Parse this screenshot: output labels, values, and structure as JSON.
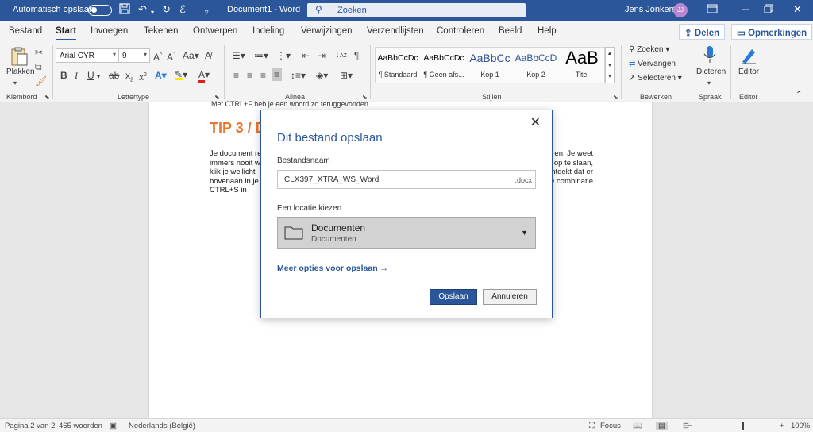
{
  "titlebar": {
    "autosave_label": "Automatisch opslaan",
    "doc_title": "Document1  -  Word",
    "search_placeholder": "Zoeken",
    "user_name": "Jens Jonkers",
    "user_initials": "JJ",
    "accent": "#2b579a"
  },
  "tabs": [
    "Bestand",
    "Start",
    "Invoegen",
    "Tekenen",
    "Ontwerpen",
    "Indeling",
    "Verwijzingen",
    "Verzendlijsten",
    "Controleren",
    "Beeld",
    "Help"
  ],
  "active_tab": "Start",
  "share": {
    "share_label": "Delen",
    "comments_label": "Opmerkingen"
  },
  "ribbon": {
    "clipboard": {
      "paste_label": "Plakken",
      "group_label": "Klembord"
    },
    "font": {
      "font_name": "Arial CYR",
      "font_size": "9",
      "group_label": "Lettertype",
      "aa_label": "Aa"
    },
    "paragraph": {
      "group_label": "Alinea"
    },
    "styles": {
      "group_label": "Stijlen",
      "items": [
        {
          "preview": "AaBbCcDc",
          "name": "¶ Standaard"
        },
        {
          "preview": "AaBbCcDc",
          "name": "¶ Geen afs..."
        },
        {
          "preview": "AaBbCc",
          "name": "Kop 1"
        },
        {
          "preview": "AaBbCcD",
          "name": "Kop 2"
        },
        {
          "preview": "AaB",
          "name": "Titel"
        }
      ]
    },
    "editing": {
      "group_label": "Bewerken",
      "find": "Zoeken",
      "replace": "Vervangen",
      "select": "Selecteren"
    },
    "voice": {
      "label": "Dicteren",
      "group_label": "Spraak"
    },
    "editor": {
      "label": "Editor",
      "group_label": "Editor"
    }
  },
  "document": {
    "header_line": "Met CTRL+F heb je een woord zo teruggevonden.",
    "tip_heading": "TIP 3 / D",
    "paragraph_lines": [
      "Je document re",
      "immers nooit w",
      "klik je wellicht ",
      "bovenaan in je",
      "CTRL+S in"
    ],
    "paragraph_tails": [
      "en. Je weet",
      "op te slaan,",
      "ntdekt dat er",
      "e combinatie"
    ]
  },
  "dialog": {
    "title": "Dit bestand opslaan",
    "filename_label": "Bestandsnaam",
    "filename_value": "CLX397_XTRA_WS_Word",
    "extension": ".docx",
    "location_label": "Een locatie kiezen",
    "location_name": "Documenten",
    "location_path": "Documenten",
    "more_options": "Meer opties voor opslaan →",
    "save_button": "Opslaan",
    "cancel_button": "Annuleren"
  },
  "statusbar": {
    "page": "Pagina 2 van 2",
    "words": "465 woorden",
    "language": "Nederlands (België)",
    "focus": "Focus",
    "zoom": "100%",
    "zoom_level_percent": 100
  }
}
